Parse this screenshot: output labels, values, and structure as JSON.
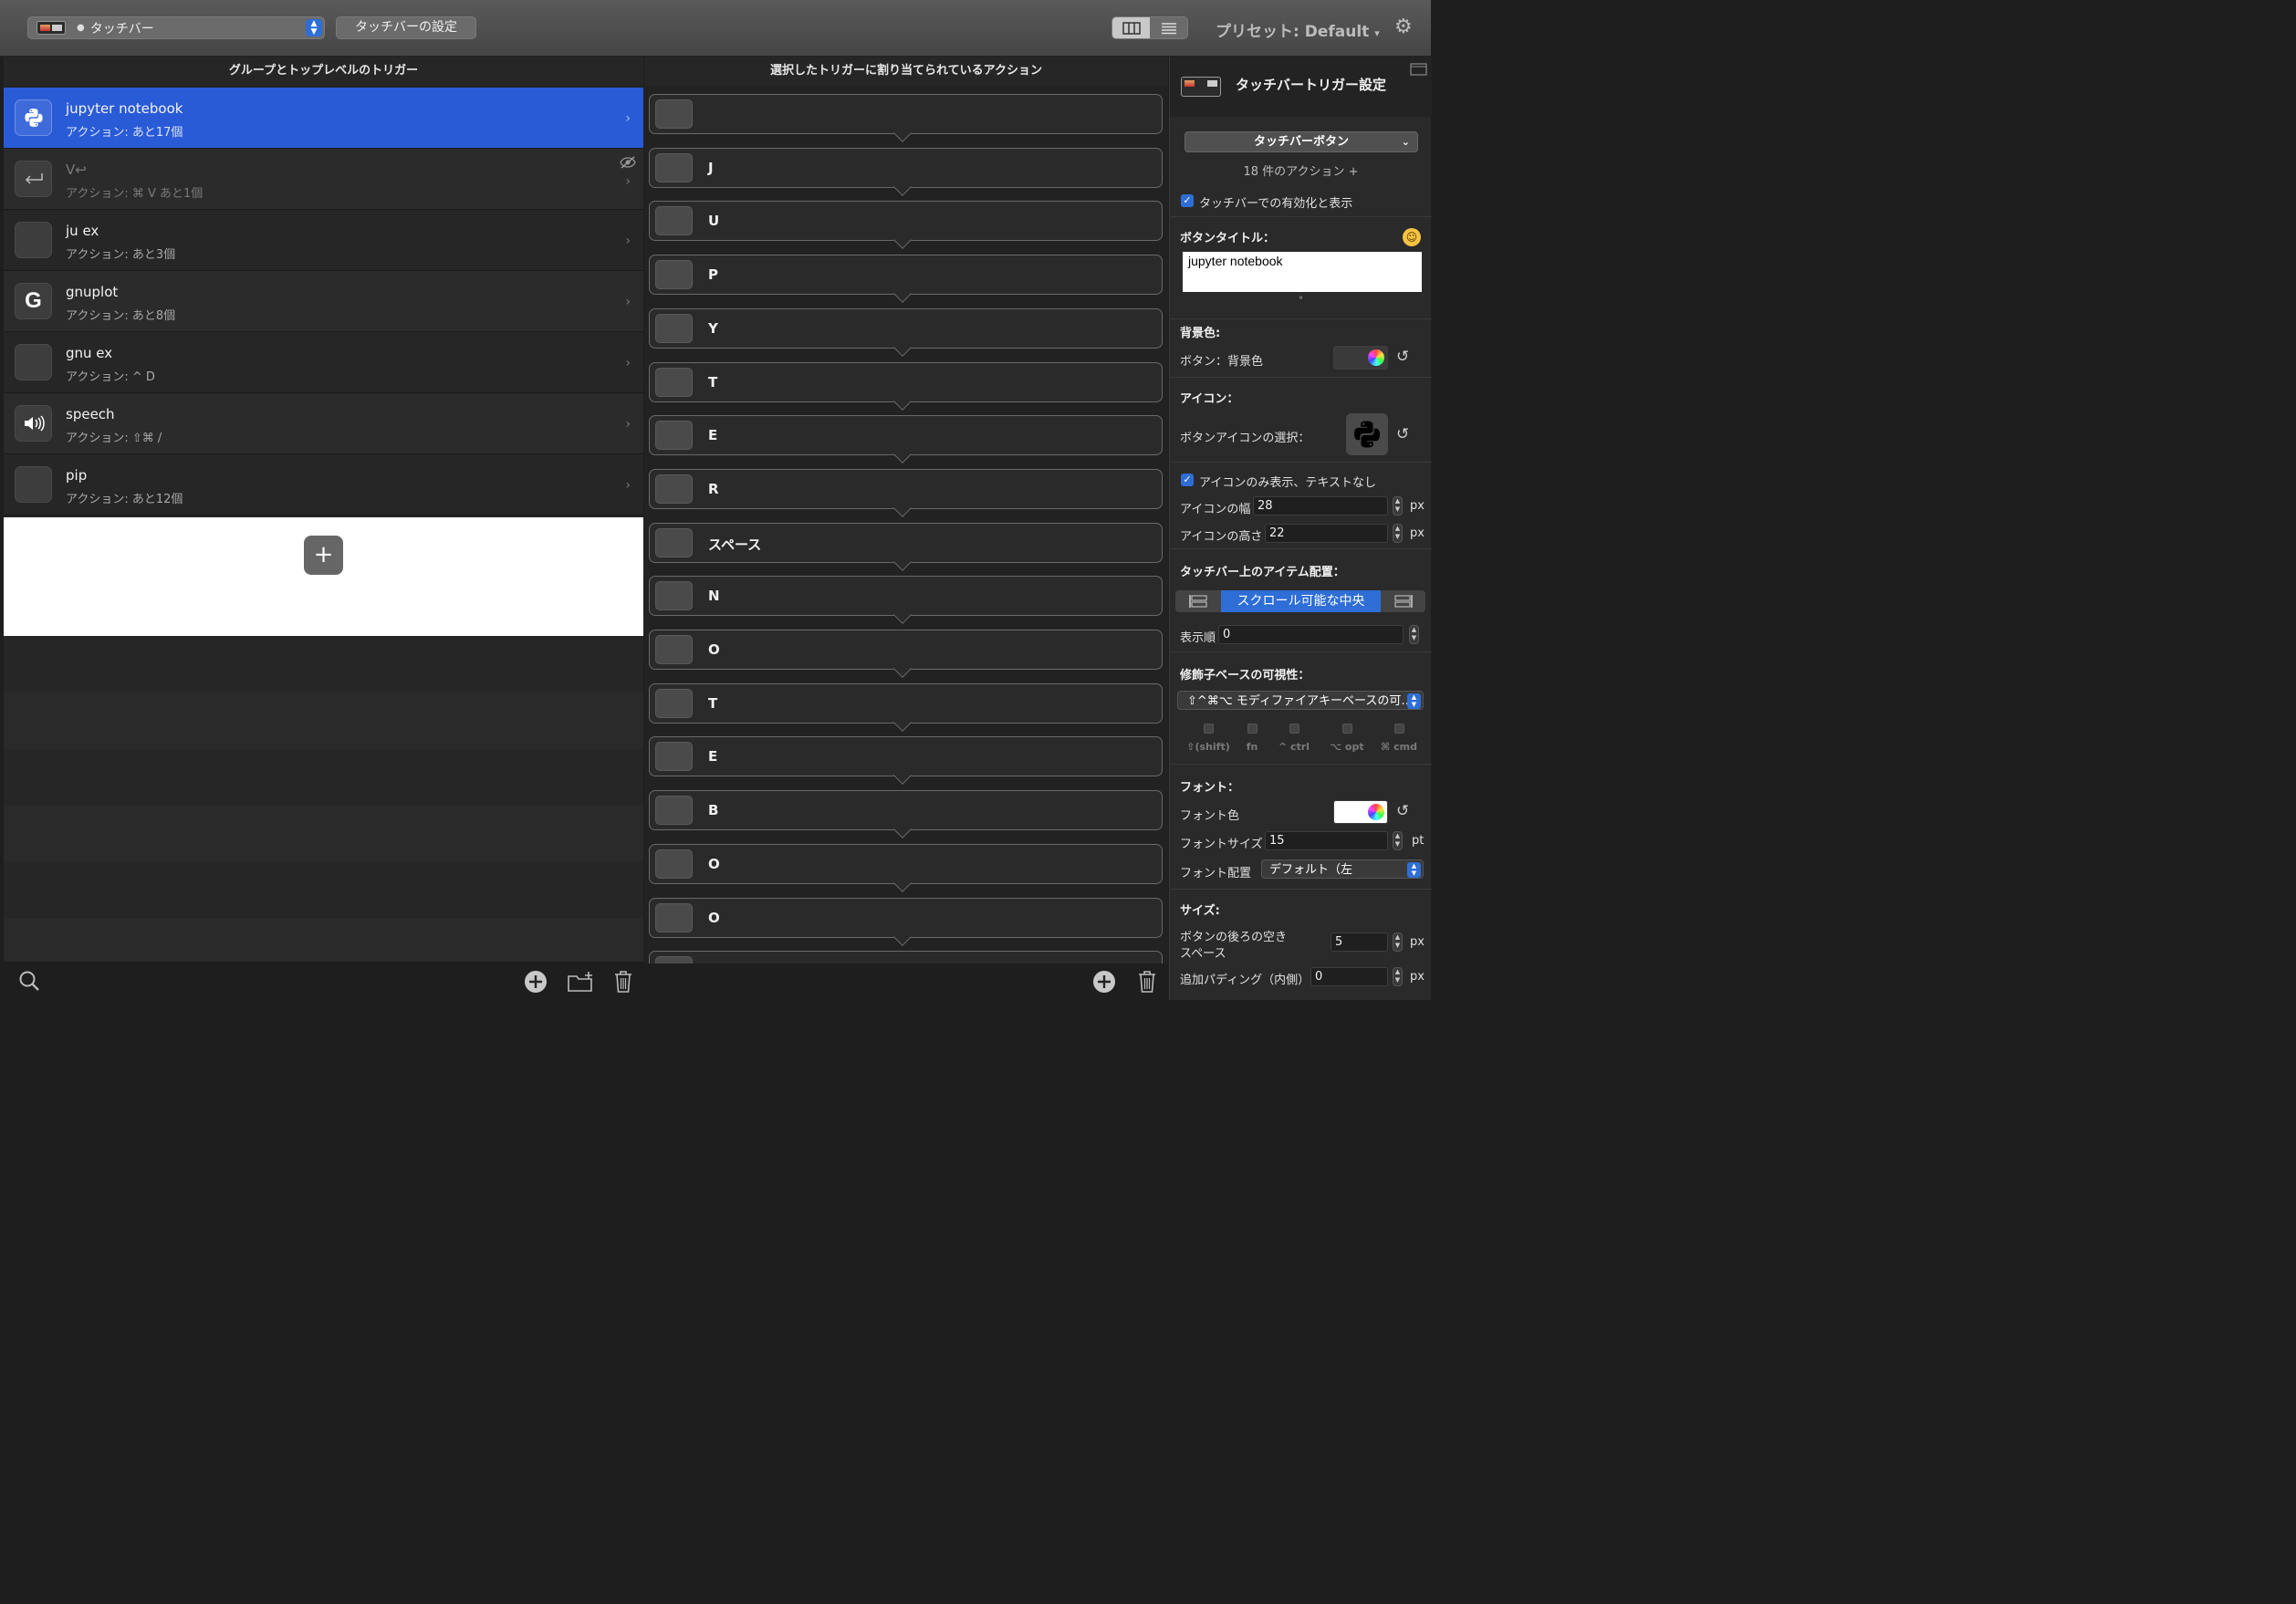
{
  "toolbar": {
    "device_label": "タッチバー",
    "settings_button": "タッチバーの設定",
    "preset_label": "プリセット: Default",
    "preset_arrow": "▾"
  },
  "headers": {
    "left": "グループとトップレベルのトリガー",
    "middle": "選択したトリガーに割り当てられているアクション"
  },
  "triggers": [
    {
      "name": "jupyter notebook",
      "sub": "アクション:  あと17個",
      "icon": "python-icon",
      "selected": true
    },
    {
      "name": "V↩",
      "sub": "アクション: ⌘ V あと1個",
      "icon": "return-icon",
      "hidden": true
    },
    {
      "name": "ju ex",
      "sub": "アクション:  あと3個",
      "icon": "blank-icon"
    },
    {
      "name": "gnuplot",
      "sub": "アクション:  あと8個",
      "icon": "google-icon"
    },
    {
      "name": "gnu ex",
      "sub": "アクション: ^ D",
      "icon": "blank-icon"
    },
    {
      "name": "speech",
      "sub": "アクション: ⇧⌘ /",
      "icon": "speaker-icon"
    },
    {
      "name": "pip",
      "sub": "アクション:  あと12個",
      "icon": "blank-icon"
    }
  ],
  "actions": [
    "",
    "J",
    "U",
    "P",
    "Y",
    "T",
    "E",
    "R",
    "スペース",
    "N",
    "O",
    "T",
    "E",
    "B",
    "O",
    "O",
    ""
  ],
  "panel": {
    "title": "タッチバートリガー設定",
    "type_select": "タッチバーボタン",
    "action_count": "18 件のアクション +",
    "enable_label": "タッチバーでの有効化と表示",
    "button_title_heading": "ボタンタイトル：",
    "button_title_value": "jupyter notebook",
    "bg_heading": "背景色:",
    "bg_label": "ボタン：背景色",
    "icon_heading": "アイコン：",
    "icon_select_label": "ボタンアイコンの選択：",
    "icon_only_label": "アイコンのみ表示、テキストなし",
    "icon_width_label": "アイコンの幅",
    "icon_width_value": "28",
    "icon_height_label": "アイコンの高さ",
    "icon_height_value": "22",
    "px": "px",
    "pt": "pt",
    "placement_heading": "タッチバー上のアイテム配置：",
    "placement_value": "スクロール可能な中央",
    "order_label": "表示順",
    "order_value": "0",
    "modifier_heading": "修飾子ベースの可視性：",
    "modifier_select": "⇧^⌘⌥ モディファイアキーベースの可…",
    "modifiers": [
      "⇧(shift)",
      "fn",
      "^ ctrl",
      "⌥ opt",
      "⌘ cmd"
    ],
    "font_heading": "フォント：",
    "font_color_label": "フォント色",
    "font_size_label": "フォントサイズ",
    "font_size_value": "15",
    "font_align_label": "フォント配置",
    "font_align_value": "デフォルト（左",
    "size_heading": "サイズ:",
    "space_after_label_1": "ボタンの後ろの空き",
    "space_after_label_2": "スペース",
    "space_after_value": "5",
    "padding_label": "追加パディング（内側）",
    "padding_value": "0"
  },
  "colors": {
    "accent": "#2a5bd7",
    "selection_blue": "#2e6ed6",
    "panel_bg": "#2a2a2a"
  }
}
